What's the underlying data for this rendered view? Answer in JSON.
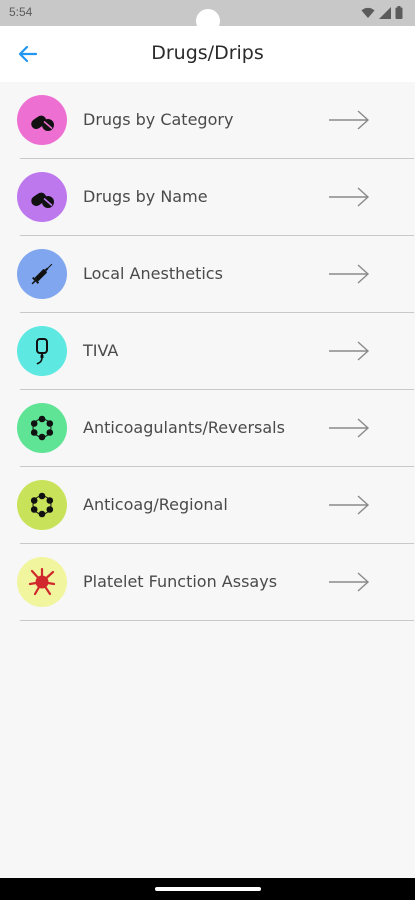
{
  "status_bar": {
    "time": "5:54",
    "icons": [
      "wifi-icon",
      "signal-icon",
      "battery-icon"
    ]
  },
  "header": {
    "title": "Drugs/Drips",
    "back_icon": "back-arrow-icon",
    "accent": "#2196f3"
  },
  "menu": [
    {
      "id": "drugs-by-category",
      "label": "Drugs by Category",
      "icon": "pill-icon",
      "color": "#ee6fd2"
    },
    {
      "id": "drugs-by-name",
      "label": "Drugs by Name",
      "icon": "pill-icon",
      "color": "#bd78ee"
    },
    {
      "id": "local-anesthetics",
      "label": "Local Anesthetics",
      "icon": "syringe-icon",
      "color": "#7fa6ee"
    },
    {
      "id": "tiva",
      "label": "TIVA",
      "icon": "iv-bag-icon",
      "color": "#5de8e2"
    },
    {
      "id": "anticoagulants-reversals",
      "label": "Anticoagulants/Reversals",
      "icon": "molecule-icon",
      "color": "#5ee494"
    },
    {
      "id": "anticoag-regional",
      "label": "Anticoag/Regional",
      "icon": "molecule-icon",
      "color": "#c8e35a"
    },
    {
      "id": "platelet-function-assays",
      "label": "Platelet Function Assays",
      "icon": "platelet-icon",
      "color": "#f0f59e"
    }
  ],
  "row_arrow_icon": "arrow-right-icon"
}
